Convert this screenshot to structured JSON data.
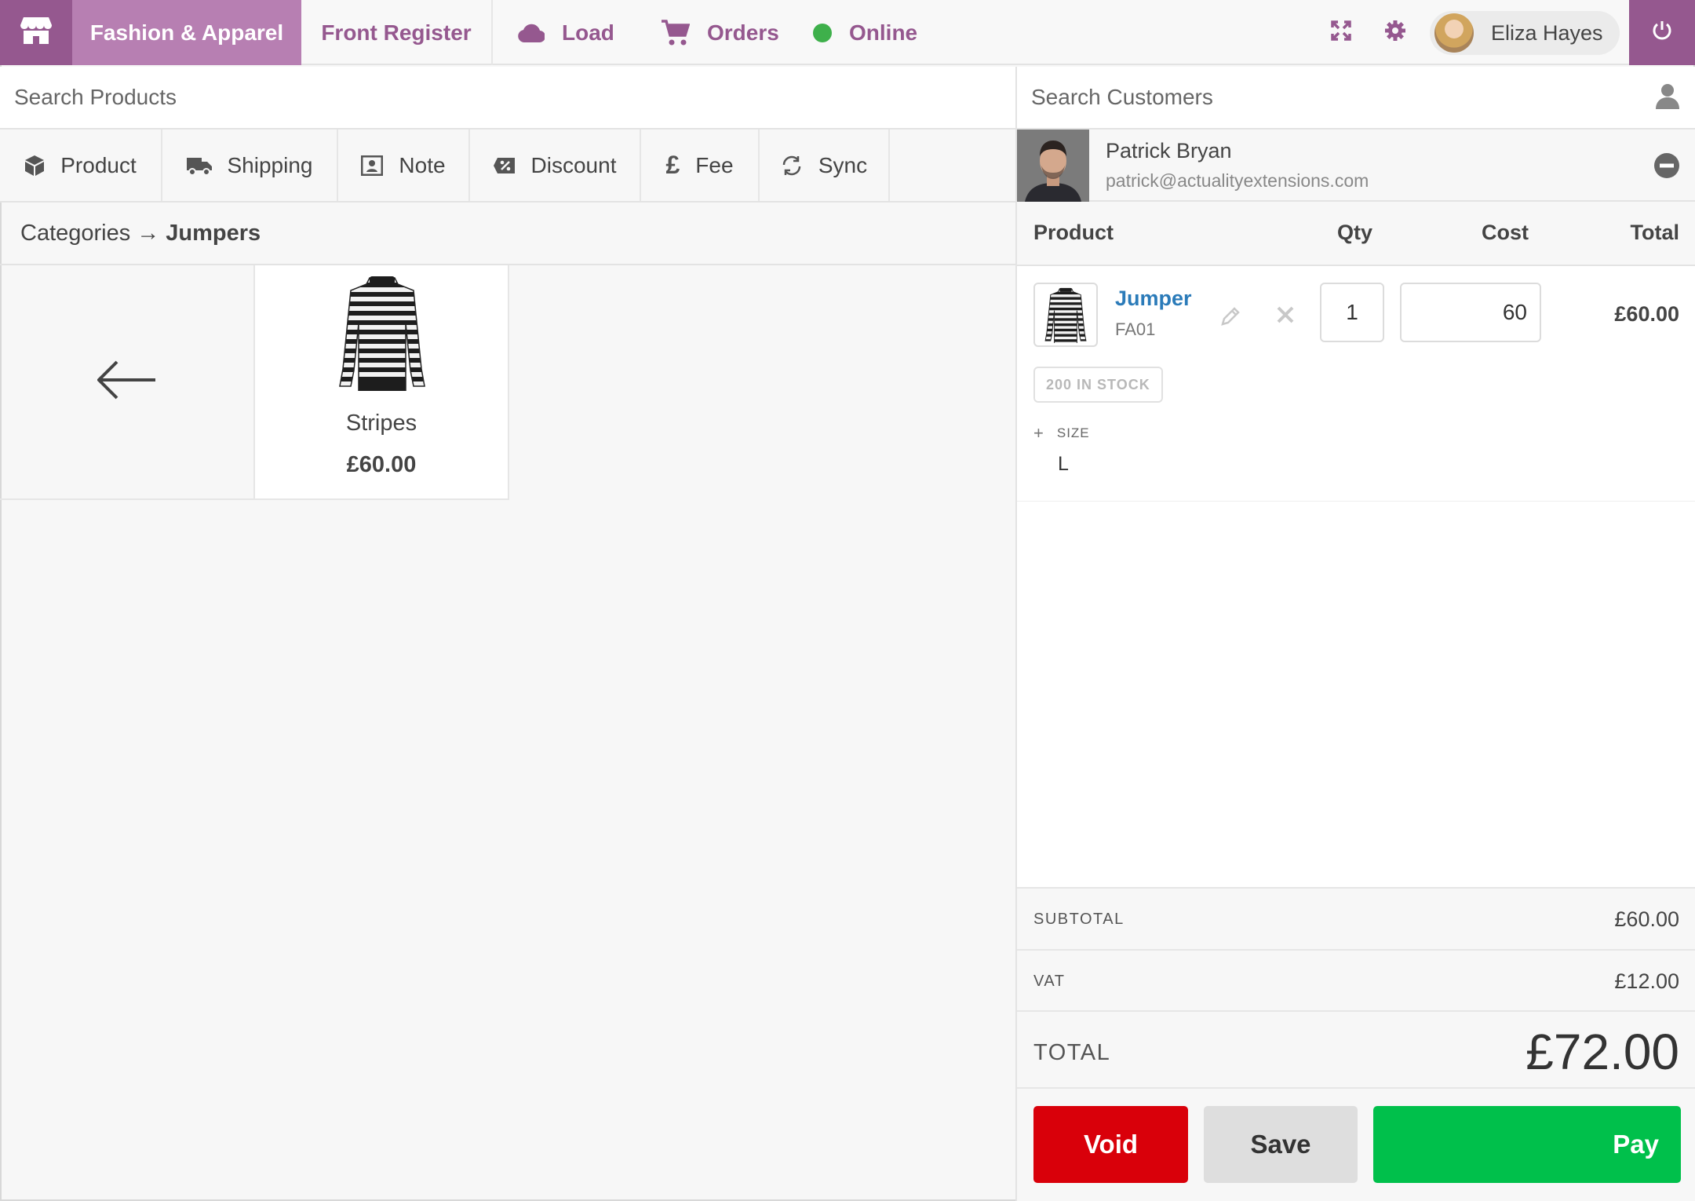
{
  "topbar": {
    "store_name": "Fashion & Apparel",
    "register_name": "Front Register",
    "load_label": "Load",
    "orders_label": "Orders",
    "status_label": "Online",
    "user_name": "Eliza Hayes",
    "accent_color": "#95588f",
    "online_color": "#3eb04b"
  },
  "left": {
    "search_placeholder": "Search Products",
    "actions": [
      {
        "label": "Product",
        "icon": "cube-icon"
      },
      {
        "label": "Shipping",
        "icon": "truck-icon"
      },
      {
        "label": "Note",
        "icon": "note-icon"
      },
      {
        "label": "Discount",
        "icon": "discount-icon"
      },
      {
        "label": "Fee",
        "icon": "pound-icon"
      },
      {
        "label": "Sync",
        "icon": "sync-icon"
      }
    ],
    "breadcrumb": {
      "root": "Categories",
      "separator": "→",
      "current": "Jumpers"
    },
    "products": [
      {
        "name": "Stripes",
        "price": "£60.00"
      }
    ]
  },
  "right": {
    "search_placeholder": "Search Customers",
    "customer": {
      "name": "Patrick Bryan",
      "email": "patrick@actualityextensions.com"
    },
    "columns": {
      "product": "Product",
      "qty": "Qty",
      "cost": "Cost",
      "total": "Total"
    },
    "items": [
      {
        "name": "Jumper",
        "sku": "FA01",
        "qty": "1",
        "cost": "60",
        "total": "£60.00",
        "stock": "200 IN STOCK",
        "meta_label": "SIZE",
        "meta_value": "L"
      }
    ],
    "totals": {
      "subtotal_label": "SUBTOTAL",
      "subtotal": "£60.00",
      "vat_label": "VAT",
      "vat": "£12.00",
      "total_label": "TOTAL",
      "total": "£72.00"
    },
    "buttons": {
      "void": "Void",
      "save": "Save",
      "pay": "Pay"
    },
    "colors": {
      "void": "#d9000a",
      "pay": "#00c04b",
      "link": "#2b7bb9"
    }
  }
}
